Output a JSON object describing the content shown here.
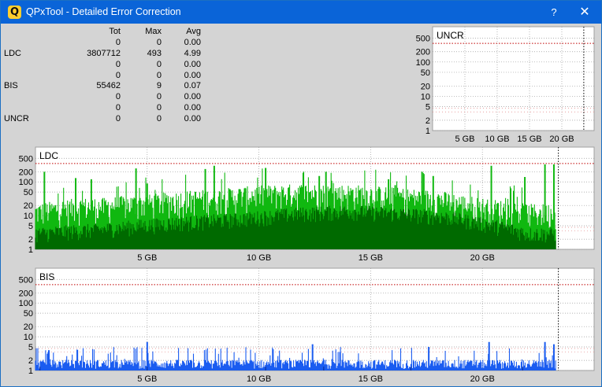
{
  "window": {
    "title": "QPxTool - Detailed Error Correction",
    "help_label": "?",
    "close_label": "✕",
    "icon_letter": "Q"
  },
  "stats": {
    "headers": {
      "tot": "Tot",
      "max": "Max",
      "avg": "Avg"
    },
    "rows": [
      {
        "label": "",
        "tot": "0",
        "max": "0",
        "avg": "0.00"
      },
      {
        "label": "LDC",
        "tot": "3807712",
        "max": "493",
        "avg": "4.99"
      },
      {
        "label": "",
        "tot": "0",
        "max": "0",
        "avg": "0.00"
      },
      {
        "label": "",
        "tot": "0",
        "max": "0",
        "avg": "0.00"
      },
      {
        "label": "BIS",
        "tot": "55462",
        "max": "9",
        "avg": "0.07"
      },
      {
        "label": "",
        "tot": "0",
        "max": "0",
        "avg": "0.00"
      },
      {
        "label": "",
        "tot": "0",
        "max": "0",
        "avg": "0.00"
      },
      {
        "label": "UNCR",
        "tot": "0",
        "max": "0",
        "avg": "0.00"
      }
    ]
  },
  "colors": {
    "ldc_light": "#10b810",
    "ldc_dark": "#006a00",
    "bis_blue": "#1a5cf0",
    "bis_dark": "#0a2a90",
    "threshold": "#c00000",
    "grid": "#9a9a9a"
  },
  "chart_data": [
    {
      "type": "area",
      "title": "UNCR",
      "scale": "log",
      "y_ticks": [
        "500",
        "200",
        "100",
        "50",
        "20",
        "10",
        "5",
        "2",
        "1"
      ],
      "y_tick_values": [
        500,
        200,
        100,
        50,
        20,
        10,
        5,
        2,
        1
      ],
      "x_ticks": [
        "5 GB",
        "10 GB",
        "15 GB",
        "20 GB"
      ],
      "x_tick_values": [
        5,
        10,
        15,
        20
      ],
      "xlim": [
        0,
        25
      ],
      "ylim": [
        1,
        700
      ],
      "end_marker": 23.4,
      "threshold_lines": [
        350
      ],
      "series": []
    },
    {
      "type": "area",
      "title": "LDC",
      "scale": "log",
      "y_ticks": [
        "500",
        "200",
        "100",
        "50",
        "20",
        "10",
        "5",
        "2",
        "1"
      ],
      "y_tick_values": [
        500,
        200,
        100,
        50,
        20,
        10,
        5,
        2,
        1
      ],
      "x_ticks": [
        "5 GB",
        "10 GB",
        "15 GB",
        "20 GB"
      ],
      "x_tick_values": [
        5,
        10,
        15,
        20
      ],
      "xlim": [
        0,
        25
      ],
      "ylim": [
        1,
        700
      ],
      "end_marker": 23.4,
      "threshold_lines": [
        350
      ],
      "series": [
        {
          "x": [
            0,
            1,
            2,
            3,
            4,
            5,
            6,
            7,
            8,
            9,
            10,
            11,
            12,
            13,
            14,
            15,
            16,
            17,
            18,
            19,
            20,
            21,
            22,
            23,
            23.3
          ],
          "values": [
            8,
            10,
            12,
            12,
            14,
            15,
            18,
            20,
            22,
            25,
            28,
            30,
            32,
            30,
            30,
            28,
            25,
            22,
            20,
            15,
            12,
            10,
            8,
            8,
            10
          ],
          "peaks_x": [
            0.4,
            1.8,
            2.5,
            4.5,
            5.0,
            7.6,
            8.0,
            10.3,
            12.7,
            13.0,
            15.8,
            16.1,
            17.3,
            17.8,
            20.4,
            21.9,
            22.8,
            23.2
          ],
          "peaks": [
            200,
            130,
            120,
            250,
            90,
            240,
            300,
            260,
            150,
            200,
            120,
            80,
            200,
            150,
            300,
            140,
            330,
            330
          ]
        },
        {
          "x": [
            0,
            3,
            6,
            9,
            12,
            14,
            16,
            18,
            20,
            22,
            23.3
          ],
          "values": [
            3,
            4,
            6,
            8,
            12,
            14,
            12,
            10,
            6,
            3,
            3
          ]
        }
      ]
    },
    {
      "type": "area",
      "title": "BIS",
      "scale": "log",
      "y_ticks": [
        "500",
        "200",
        "100",
        "50",
        "20",
        "10",
        "5",
        "2",
        "1"
      ],
      "y_tick_values": [
        500,
        200,
        100,
        50,
        20,
        10,
        5,
        2,
        1
      ],
      "x_ticks": [
        "5 GB",
        "10 GB",
        "15 GB",
        "20 GB"
      ],
      "x_tick_values": [
        5,
        10,
        15,
        20
      ],
      "xlim": [
        0,
        25
      ],
      "ylim": [
        1,
        700
      ],
      "end_marker": 23.4,
      "threshold_lines": [
        350
      ],
      "series": [
        {
          "x": [
            0,
            23.3
          ],
          "values": [
            1.6,
            1.6
          ],
          "peaks_x": [
            0.6,
            5.0,
            12.4,
            17.6,
            20.3,
            22.8,
            23.2
          ],
          "peaks": [
            4,
            7,
            6,
            5,
            7,
            7,
            6
          ]
        }
      ]
    }
  ]
}
